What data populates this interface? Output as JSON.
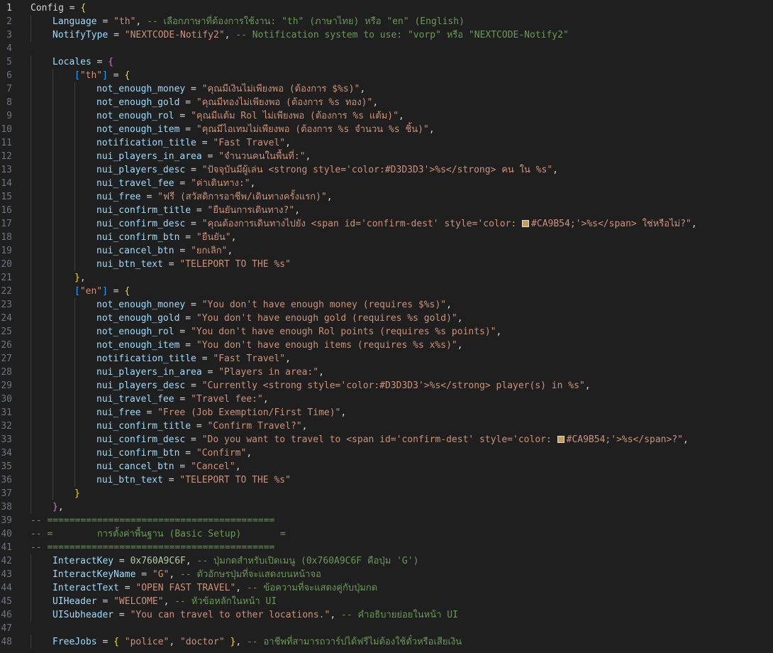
{
  "editor": {
    "swatch_color": "#CA9B54",
    "lines": [
      [
        [
          "b",
          "",
          "Config"
        ],
        [
          "p",
          " = "
        ],
        [
          "b1",
          "{"
        ]
      ],
      [
        [
          "i",
          "Language"
        ],
        [
          "p",
          " = "
        ],
        [
          "s",
          "\"th\""
        ],
        [
          "p",
          ", "
        ],
        [
          "c",
          "-- เลือกภาษาที่ต้องการใช้งาน: \"th\" (ภาษาไทย) หรือ \"en\" (English)"
        ]
      ],
      [
        [
          "i",
          "NotifyType"
        ],
        [
          "p",
          " = "
        ],
        [
          "s",
          "\"NEXTCODE-Notify2\""
        ],
        [
          "p",
          ", "
        ],
        [
          "c",
          "-- Notification system to use: \"vorp\" หรือ \"NEXTCODE-Notify2\""
        ]
      ],
      [],
      [
        [
          "i",
          "Locales"
        ],
        [
          "p",
          " = "
        ],
        [
          "b2",
          "{"
        ]
      ],
      [
        [
          "b3",
          "["
        ],
        [
          "s",
          "\"th\""
        ],
        [
          "b3",
          "]"
        ],
        [
          "p",
          " = "
        ],
        [
          "b1",
          "{"
        ]
      ],
      [
        [
          "i",
          "not_enough_money"
        ],
        [
          "p",
          " = "
        ],
        [
          "s",
          "\"คุณมีเงินไม่เพียงพอ (ต้องการ $%s)\""
        ],
        [
          "p",
          ","
        ]
      ],
      [
        [
          "i",
          "not_enough_gold"
        ],
        [
          "p",
          " = "
        ],
        [
          "s",
          "\"คุณมีทองไม่เพียงพอ (ต้องการ %s ทอง)\""
        ],
        [
          "p",
          ","
        ]
      ],
      [
        [
          "i",
          "not_enough_rol"
        ],
        [
          "p",
          " = "
        ],
        [
          "s",
          "\"คุณมีแต้ม Rol ไม่เพียงพอ (ต้องการ %s แต้ม)\""
        ],
        [
          "p",
          ","
        ]
      ],
      [
        [
          "i",
          "not_enough_item"
        ],
        [
          "p",
          " = "
        ],
        [
          "s",
          "\"คุณมีไอเทมไม่เพียงพอ (ต้องการ %s จำนวน %s ชิ้น)\""
        ],
        [
          "p",
          ","
        ]
      ],
      [
        [
          "i",
          "notification_title"
        ],
        [
          "p",
          " = "
        ],
        [
          "s",
          "\"Fast Travel\""
        ],
        [
          "p",
          ","
        ]
      ],
      [
        [
          "i",
          "nui_players_in_area"
        ],
        [
          "p",
          " = "
        ],
        [
          "s",
          "\"จำนวนคนในพื้นที่:\""
        ],
        [
          "p",
          ","
        ]
      ],
      [
        [
          "i",
          "nui_players_desc"
        ],
        [
          "p",
          " = "
        ],
        [
          "s",
          "\"ปัจจุบันมีผู้เล่น <strong style='color:#D3D3D3'>%s</strong> คน ใน %s\""
        ],
        [
          "p",
          ","
        ]
      ],
      [
        [
          "i",
          "nui_travel_fee"
        ],
        [
          "p",
          " = "
        ],
        [
          "s",
          "\"ค่าเดินทาง:\""
        ],
        [
          "p",
          ","
        ]
      ],
      [
        [
          "i",
          "nui_free"
        ],
        [
          "p",
          " = "
        ],
        [
          "s",
          "\"ฟรี (สวัสดิการอาชีพ/เดินทางครั้งแรก)\""
        ],
        [
          "p",
          ","
        ]
      ],
      [
        [
          "i",
          "nui_confirm_title"
        ],
        [
          "p",
          " = "
        ],
        [
          "s",
          "\"ยืนยันการเดินทาง?\""
        ],
        [
          "p",
          ","
        ]
      ],
      [
        [
          "i",
          "nui_confirm_desc"
        ],
        [
          "p",
          " = "
        ],
        [
          "s",
          "\"คุณต้องการเดินทางไปยัง <span id='confirm-dest' style='color: "
        ],
        [
          "sw",
          ""
        ],
        [
          "s",
          "#CA9B54;'>%s</span> ใช่หรือไม่?\""
        ],
        [
          "p",
          ","
        ]
      ],
      [
        [
          "i",
          "nui_confirm_btn"
        ],
        [
          "p",
          " = "
        ],
        [
          "s",
          "\"ยืนยัน\""
        ],
        [
          "p",
          ","
        ]
      ],
      [
        [
          "i",
          "nui_cancel_btn"
        ],
        [
          "p",
          " = "
        ],
        [
          "s",
          "\"ยกเลิก\""
        ],
        [
          "p",
          ","
        ]
      ],
      [
        [
          "i",
          "nui_btn_text"
        ],
        [
          "p",
          " = "
        ],
        [
          "s",
          "\"TELEPORT TO THE %s\""
        ]
      ],
      [
        [
          "b1",
          "}"
        ],
        [
          "p",
          ","
        ]
      ],
      [
        [
          "b3",
          "["
        ],
        [
          "s",
          "\"en\""
        ],
        [
          "b3",
          "]"
        ],
        [
          "p",
          " = "
        ],
        [
          "b1",
          "{"
        ]
      ],
      [
        [
          "i",
          "not_enough_money"
        ],
        [
          "p",
          " = "
        ],
        [
          "s",
          "\"You don't have enough money (requires $%s)\""
        ],
        [
          "p",
          ","
        ]
      ],
      [
        [
          "i",
          "not_enough_gold"
        ],
        [
          "p",
          " = "
        ],
        [
          "s",
          "\"You don't have enough gold (requires %s gold)\""
        ],
        [
          "p",
          ","
        ]
      ],
      [
        [
          "i",
          "not_enough_rol"
        ],
        [
          "p",
          " = "
        ],
        [
          "s",
          "\"You don't have enough Rol points (requires %s points)\""
        ],
        [
          "p",
          ","
        ]
      ],
      [
        [
          "i",
          "not_enough_item"
        ],
        [
          "p",
          " = "
        ],
        [
          "s",
          "\"You don't have enough items (requires %s x%s)\""
        ],
        [
          "p",
          ","
        ]
      ],
      [
        [
          "i",
          "notification_title"
        ],
        [
          "p",
          " = "
        ],
        [
          "s",
          "\"Fast Travel\""
        ],
        [
          "p",
          ","
        ]
      ],
      [
        [
          "i",
          "nui_players_in_area"
        ],
        [
          "p",
          " = "
        ],
        [
          "s",
          "\"Players in area:\""
        ],
        [
          "p",
          ","
        ]
      ],
      [
        [
          "i",
          "nui_players_desc"
        ],
        [
          "p",
          " = "
        ],
        [
          "s",
          "\"Currently <strong style='color:#D3D3D3'>%s</strong> player(s) in %s\""
        ],
        [
          "p",
          ","
        ]
      ],
      [
        [
          "i",
          "nui_travel_fee"
        ],
        [
          "p",
          " = "
        ],
        [
          "s",
          "\"Travel fee:\""
        ],
        [
          "p",
          ","
        ]
      ],
      [
        [
          "i",
          "nui_free"
        ],
        [
          "p",
          " = "
        ],
        [
          "s",
          "\"Free (Job Exemption/First Time)\""
        ],
        [
          "p",
          ","
        ]
      ],
      [
        [
          "i",
          "nui_confirm_title"
        ],
        [
          "p",
          " = "
        ],
        [
          "s",
          "\"Confirm Travel?\""
        ],
        [
          "p",
          ","
        ]
      ],
      [
        [
          "i",
          "nui_confirm_desc"
        ],
        [
          "p",
          " = "
        ],
        [
          "s",
          "\"Do you want to travel to <span id='confirm-dest' style='color: "
        ],
        [
          "sw",
          ""
        ],
        [
          "s",
          "#CA9B54;'>%s</span>?\""
        ],
        [
          "p",
          ","
        ]
      ],
      [
        [
          "i",
          "nui_confirm_btn"
        ],
        [
          "p",
          " = "
        ],
        [
          "s",
          "\"Confirm\""
        ],
        [
          "p",
          ","
        ]
      ],
      [
        [
          "i",
          "nui_cancel_btn"
        ],
        [
          "p",
          " = "
        ],
        [
          "s",
          "\"Cancel\""
        ],
        [
          "p",
          ","
        ]
      ],
      [
        [
          "i",
          "nui_btn_text"
        ],
        [
          "p",
          " = "
        ],
        [
          "s",
          "\"TELEPORT TO THE %s\""
        ]
      ],
      [
        [
          "b1",
          "}"
        ]
      ],
      [
        [
          "b2",
          "}"
        ],
        [
          "p",
          ","
        ]
      ],
      [
        [
          "c",
          "-- ========================================="
        ]
      ],
      [
        [
          "c",
          "-- =        การตั้งค่าพื้นฐาน (Basic Setup)       ="
        ]
      ],
      [
        [
          "c",
          "-- ========================================="
        ]
      ],
      [
        [
          "i",
          "InteractKey"
        ],
        [
          "p",
          " = "
        ],
        [
          "n",
          "0x760A9C6F"
        ],
        [
          "p",
          ", "
        ],
        [
          "c",
          "-- ปุ่มกดสำหรับเปิดเมนู (0x760A9C6F คือปุ่ม 'G')"
        ]
      ],
      [
        [
          "i",
          "InteractKeyName"
        ],
        [
          "p",
          " = "
        ],
        [
          "s",
          "\"G\""
        ],
        [
          "p",
          ", "
        ],
        [
          "c",
          "-- ตัวอักษรปุ่มที่จะแสดงบนหน้าจอ"
        ]
      ],
      [
        [
          "i",
          "InteractText"
        ],
        [
          "p",
          " = "
        ],
        [
          "s",
          "\"OPEN FAST TRAVEL\""
        ],
        [
          "p",
          ", "
        ],
        [
          "c",
          "-- ข้อความที่จะแสดงคู่กับปุ่มกด"
        ]
      ],
      [
        [
          "i",
          "UIHeader"
        ],
        [
          "p",
          " = "
        ],
        [
          "s",
          "\"WELCOME\""
        ],
        [
          "p",
          ", "
        ],
        [
          "c",
          "-- หัวข้อหลักในหน้า UI"
        ]
      ],
      [
        [
          "i",
          "UISubheader"
        ],
        [
          "p",
          " = "
        ],
        [
          "s",
          "\"You can travel to other locations.\""
        ],
        [
          "p",
          ", "
        ],
        [
          "c",
          "-- คำอธิบายย่อยในหน้า UI"
        ]
      ],
      [],
      [
        [
          "i",
          "FreeJobs"
        ],
        [
          "p",
          " = "
        ],
        [
          "b1",
          "{"
        ],
        [
          "p",
          " "
        ],
        [
          "s",
          "\"police\""
        ],
        [
          "p",
          ", "
        ],
        [
          "s",
          "\"doctor\""
        ],
        [
          "p",
          " "
        ],
        [
          "b1",
          "}"
        ],
        [
          "p",
          ", "
        ],
        [
          "c",
          "-- อาชีพที่สามารถวาร์ปได้ฟรีไม่ต้องใช้ตั๋วหรือเสียเงิน"
        ]
      ]
    ]
  }
}
